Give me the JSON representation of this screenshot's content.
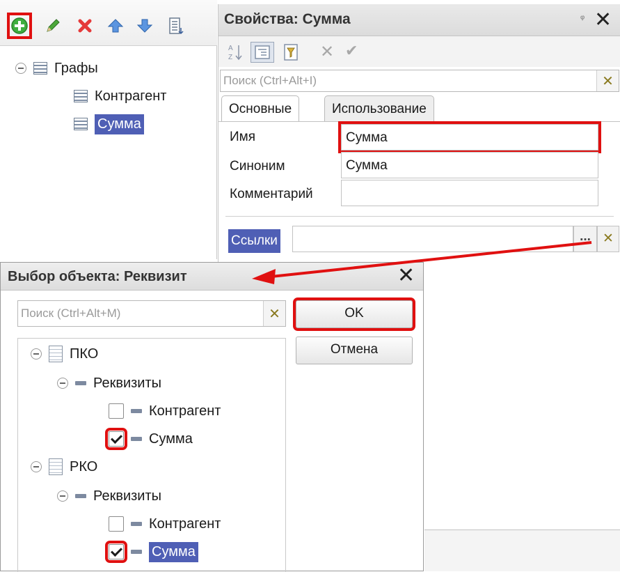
{
  "tree_panel": {
    "toolbar_icons": [
      "add-icon",
      "edit-icon",
      "delete-icon",
      "move-up-icon",
      "move-down-icon",
      "list-icon"
    ],
    "root_label": "Графы",
    "items": [
      {
        "label": "Контрагент",
        "selected": false
      },
      {
        "label": "Сумма",
        "selected": true
      }
    ]
  },
  "properties": {
    "title": "Свойства: Сумма",
    "toolbar_icons": [
      "sort-alpha-icon",
      "categories-icon",
      "filter-icon",
      "cancel-icon",
      "apply-icon"
    ],
    "search_placeholder": "Поиск (Ctrl+Alt+I)",
    "tabs": [
      "Основные",
      "Использование"
    ],
    "fields": {
      "name_label": "Имя",
      "name_value": "Сумма",
      "synonym_label": "Синоним",
      "synonym_value": "Сумма",
      "comment_label": "Комментарий",
      "comment_value": ""
    },
    "links_label": "Ссылки",
    "links_button": "...",
    "pin_icon": "pin-icon"
  },
  "dialog": {
    "title": "Выбор объекта: Реквизит",
    "search_placeholder": "Поиск (Ctrl+Alt+M)",
    "ok_label": "OK",
    "cancel_label": "Отмена",
    "tree": [
      {
        "label": "ПКО",
        "group_label": "Реквизиты",
        "attributes": [
          {
            "label": "Контрагент",
            "checked": false
          },
          {
            "label": "Сумма",
            "checked": true
          }
        ]
      },
      {
        "label": "РКО",
        "group_label": "Реквизиты",
        "attributes": [
          {
            "label": "Контрагент",
            "checked": false
          },
          {
            "label": "Сумма",
            "checked": true
          }
        ]
      }
    ]
  },
  "colors": {
    "selection": "#4f5fb5",
    "highlight": "#e01010",
    "arrow": "#e01010"
  }
}
